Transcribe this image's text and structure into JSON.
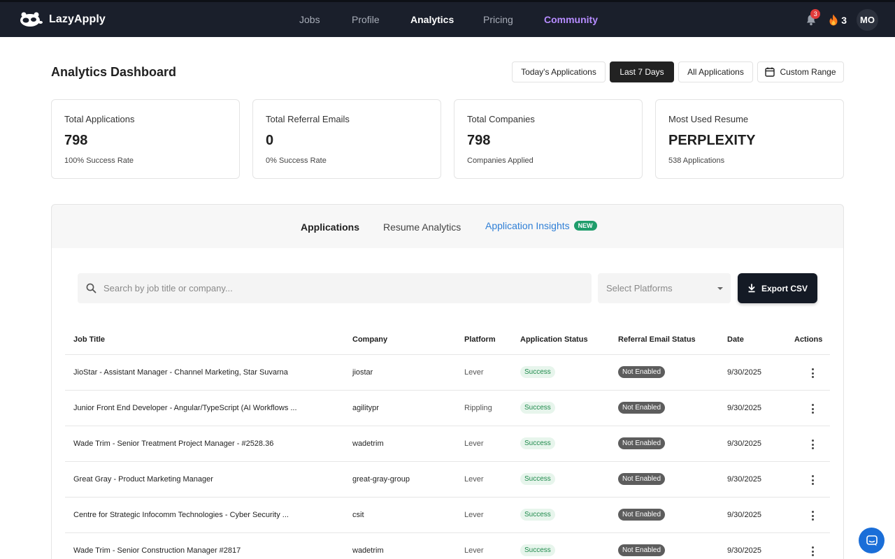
{
  "brand": {
    "name": "LazyApply"
  },
  "nav": {
    "links": [
      "Jobs",
      "Profile",
      "Analytics",
      "Pricing",
      "Community"
    ],
    "notifications": "3",
    "streak": "3",
    "avatar": "MO"
  },
  "header": {
    "title": "Analytics Dashboard",
    "ranges": [
      "Today's Applications",
      "Last 7 Days",
      "All Applications",
      "Custom Range"
    ],
    "active_range": "Last 7 Days"
  },
  "stats": [
    {
      "label": "Total Applications",
      "value": "798",
      "sub": "100% Success Rate"
    },
    {
      "label": "Total Referral Emails",
      "value": "0",
      "sub": "0% Success Rate"
    },
    {
      "label": "Total Companies",
      "value": "798",
      "sub": "Companies Applied"
    },
    {
      "label": "Most Used Resume",
      "value": "PERPLEXITY",
      "sub": "538 Applications"
    }
  ],
  "tabs": {
    "items": [
      "Applications",
      "Resume Analytics",
      "Application Insights"
    ],
    "new_badge": "NEW"
  },
  "toolbar": {
    "search_placeholder": "Search by job title or company...",
    "platform_placeholder": "Select Platforms",
    "export_label": "Export CSV"
  },
  "table": {
    "columns": [
      "Job Title",
      "Company",
      "Platform",
      "Application Status",
      "Referral Email Status",
      "Date",
      "Actions"
    ],
    "rows": [
      {
        "title": "JioStar - Assistant Manager - Channel Marketing, Star Suvarna",
        "company": "jiostar",
        "platform": "Lever",
        "status": "Success",
        "referral": "Not Enabled",
        "date": "9/30/2025"
      },
      {
        "title": "Junior Front End Developer - Angular/TypeScript (AI Workflows ...",
        "company": "agilitypr",
        "platform": "Rippling",
        "status": "Success",
        "referral": "Not Enabled",
        "date": "9/30/2025"
      },
      {
        "title": "Wade Trim - Senior Treatment Project Manager - #2528.36",
        "company": "wadetrim",
        "platform": "Lever",
        "status": "Success",
        "referral": "Not Enabled",
        "date": "9/30/2025"
      },
      {
        "title": "Great Gray - Product Marketing Manager",
        "company": "great-gray-group",
        "platform": "Lever",
        "status": "Success",
        "referral": "Not Enabled",
        "date": "9/30/2025"
      },
      {
        "title": "Centre for Strategic Infocomm Technologies - Cyber Security ...",
        "company": "csit",
        "platform": "Lever",
        "status": "Success",
        "referral": "Not Enabled",
        "date": "9/30/2025"
      },
      {
        "title": "Wade Trim - Senior Construction Manager #2817",
        "company": "wadetrim",
        "platform": "Lever",
        "status": "Success",
        "referral": "Not Enabled",
        "date": "9/30/2025"
      }
    ]
  },
  "colors": {
    "nav_bg": "#1a1f2b",
    "community": "#b68cff",
    "insights": "#2f7fd6",
    "new_badge": "#1f9d6b",
    "success_bg": "#e7f5ec",
    "success_text": "#1f8a4c",
    "chat": "#1a6ed8"
  }
}
